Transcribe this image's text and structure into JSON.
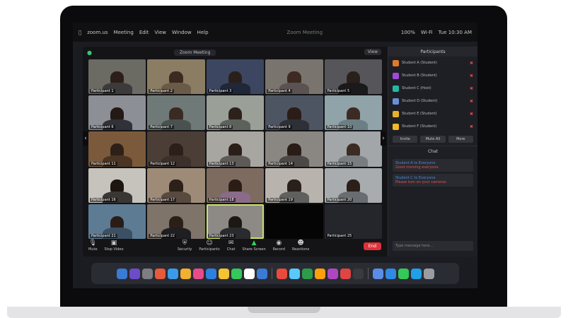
{
  "menubar": {
    "items": [
      "zoom.us",
      "Meeting",
      "Edit",
      "View",
      "Window",
      "Help"
    ],
    "title": "Zoom Meeting",
    "status_items": [
      "100%",
      "Wi-Fi",
      "Tue 10:30 AM"
    ]
  },
  "meeting": {
    "title": "Zoom Meeting",
    "view_label": "View"
  },
  "tiles": [
    {
      "name": "Participant 1",
      "bg": "#6b6a63",
      "head": "#2c1e18",
      "body": "#3d3a3c"
    },
    {
      "name": "Participant 2",
      "bg": "#8a7d63",
      "head": "#3a2a1f",
      "body": "#6a5a48"
    },
    {
      "name": "Participant 3",
      "bg": "#3c4660",
      "head": "#2a1f1a",
      "body": "#1f2738"
    },
    {
      "name": "Participant 4",
      "bg": "#7a746e",
      "head": "#3d2a22",
      "body": "#5b5352"
    },
    {
      "name": "Participant 5",
      "bg": "#56565a",
      "head": "#2a201b",
      "body": "#1a1a1c"
    },
    {
      "name": "Participant 6",
      "bg": "#8c8f95",
      "head": "#241a15",
      "body": "#303238"
    },
    {
      "name": "Participant 7",
      "bg": "#6f7a78",
      "head": "#3a2b22",
      "body": "#4a5250"
    },
    {
      "name": "Participant 8",
      "bg": "#9aa098",
      "head": "#2d211b",
      "body": "#5c615c"
    },
    {
      "name": "Participant 9",
      "bg": "#4e5562",
      "head": "#2a1d17",
      "body": "#2d3036"
    },
    {
      "name": "Participant 10",
      "bg": "#8fa3a8",
      "head": "#3b2b22",
      "body": "#6c7f84"
    },
    {
      "name": "Participant 11",
      "bg": "#7b5a3c",
      "head": "#2e2018",
      "body": "#4a3524"
    },
    {
      "name": "Participant 12",
      "bg": "#4a3e36",
      "head": "#2c1f19",
      "body": "#3b302a"
    },
    {
      "name": "Participant 13",
      "bg": "#a8a6a0",
      "head": "#2b1f19",
      "body": "#5e5b57"
    },
    {
      "name": "Participant 14",
      "bg": "#8a8682",
      "head": "#2a1c16",
      "body": "#4c4845"
    },
    {
      "name": "Participant 15",
      "bg": "#a2a6a8",
      "head": "#3b2b22",
      "body": "#7a7d80"
    },
    {
      "name": "Participant 16",
      "bg": "#c6c3bc",
      "head": "#1c1512",
      "body": "#3a3633"
    },
    {
      "name": "Participant 17",
      "bg": "#9d8b78",
      "head": "#2d2019",
      "body": "#584a3f"
    },
    {
      "name": "Participant 18",
      "bg": "#7d6b60",
      "head": "#2a1d17",
      "body": "#8b6b8a"
    },
    {
      "name": "Participant 19",
      "bg": "#b8b4ad",
      "head": "#2a201b",
      "body": "#60605e"
    },
    {
      "name": "Participant 20",
      "bg": "#a8acae",
      "head": "#2b1f19",
      "body": "#6a6d70"
    },
    {
      "name": "Participant 21",
      "bg": "#5e7b94",
      "head": "#2a1d17",
      "body": "#3c5064"
    },
    {
      "name": "Participant 22",
      "bg": "#7e746a",
      "head": "#2c1f18",
      "body": "#1f1f22"
    },
    {
      "name": "Participant 23",
      "bg": "#8d8a85",
      "head": "#1e1814",
      "body": "#2a2b2e",
      "active": true
    },
    {
      "name": "",
      "bg": "#050505",
      "head": "#050505",
      "body": "#050505",
      "blank": true
    },
    {
      "name": "Participant 25",
      "bg": "#25262b",
      "head": "#25262b",
      "body": "#25262b"
    }
  ],
  "sidebar": {
    "header": "Participants",
    "participants": [
      {
        "name": "Student A (Student)",
        "color": "#e07a2a"
      },
      {
        "name": "Student B (Student)",
        "color": "#a24ad8"
      },
      {
        "name": "Student C (Host)",
        "color": "#25b6a3"
      },
      {
        "name": "Student D (Student)",
        "color": "#6a8fd8"
      },
      {
        "name": "Student E (Student)",
        "color": "#e8b02a"
      },
      {
        "name": "Student F (Student)",
        "color": "#f0b82a"
      }
    ],
    "buttons": [
      "Invite",
      "Mute All",
      "More"
    ],
    "chat_header": "Chat",
    "messages": [
      {
        "from": "Student A to Everyone",
        "text": "Good morning everyone"
      },
      {
        "from": "Student C to Everyone",
        "text": "Please turn on your cameras"
      }
    ],
    "chat_placeholder": "Type message here..."
  },
  "toolbar": {
    "mute": "Mute",
    "video": "Stop Video",
    "security": "Security",
    "participants": "Participants",
    "chat": "Chat",
    "share": "Share Screen",
    "record": "Record",
    "reactions": "Reactions",
    "end": "End"
  },
  "dock_icons": [
    "#3a7bd5",
    "#6c4cc9",
    "#7d7d82",
    "#e85a3a",
    "#3a9be8",
    "#f0b030",
    "#e94b8a",
    "#2e80e0",
    "#f4c430",
    "#34c759",
    "#ffffff",
    "#3a7bd5",
    "#e84a3c",
    "#5ac8fa",
    "#2d9c4a",
    "#ff9f0a",
    "#b146c2",
    "#e04444",
    "#3a3a3e",
    "#5a8de8",
    "#2f8ae5",
    "#34c759",
    "#1fa0e8",
    "#9a9ca2"
  ]
}
